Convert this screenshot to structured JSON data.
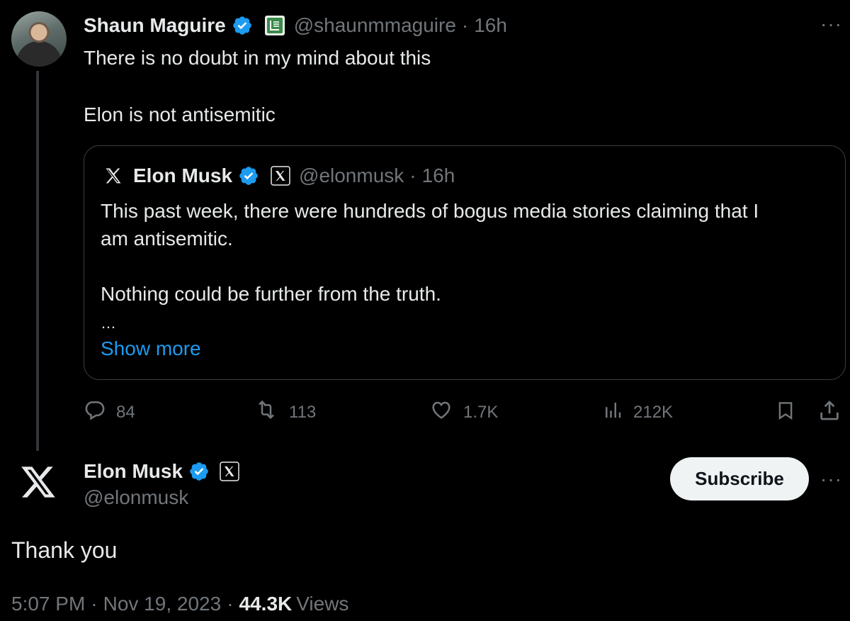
{
  "top_tweet": {
    "name": "Shaun Maguire",
    "handle": "@shaunmmaguire",
    "separator": "·",
    "time": "16h",
    "line1": "There is no doubt in my mind about this",
    "line2": "Elon is not antisemitic",
    "more": "···"
  },
  "quoted": {
    "name": "Elon Musk",
    "handle": "@elonmusk",
    "separator": "·",
    "time": "16h",
    "line1": "This past week, there were hundreds of bogus media stories claiming that I",
    "line2": "am antisemitic.",
    "line3": "Nothing could be further from the truth.",
    "ellipsis": "…",
    "show_more": "Show more"
  },
  "actions": {
    "replies": "84",
    "reposts": "113",
    "likes": "1.7K",
    "views": "212K"
  },
  "main_tweet": {
    "name": "Elon Musk",
    "handle": "@elonmusk",
    "subscribe_label": "Subscribe",
    "more": "···",
    "text": "Thank you",
    "time": "5:07 PM",
    "dot1": "·",
    "date": "Nov 19, 2023",
    "dot2": "·",
    "views_count": "44.3K",
    "views_label": "Views"
  },
  "colors": {
    "background": "#000000",
    "text": "#e7e9ea",
    "muted": "#71767b",
    "accent": "#1d9bf0",
    "verified": "#1d9bf0",
    "button_bg": "#eff3f4"
  }
}
